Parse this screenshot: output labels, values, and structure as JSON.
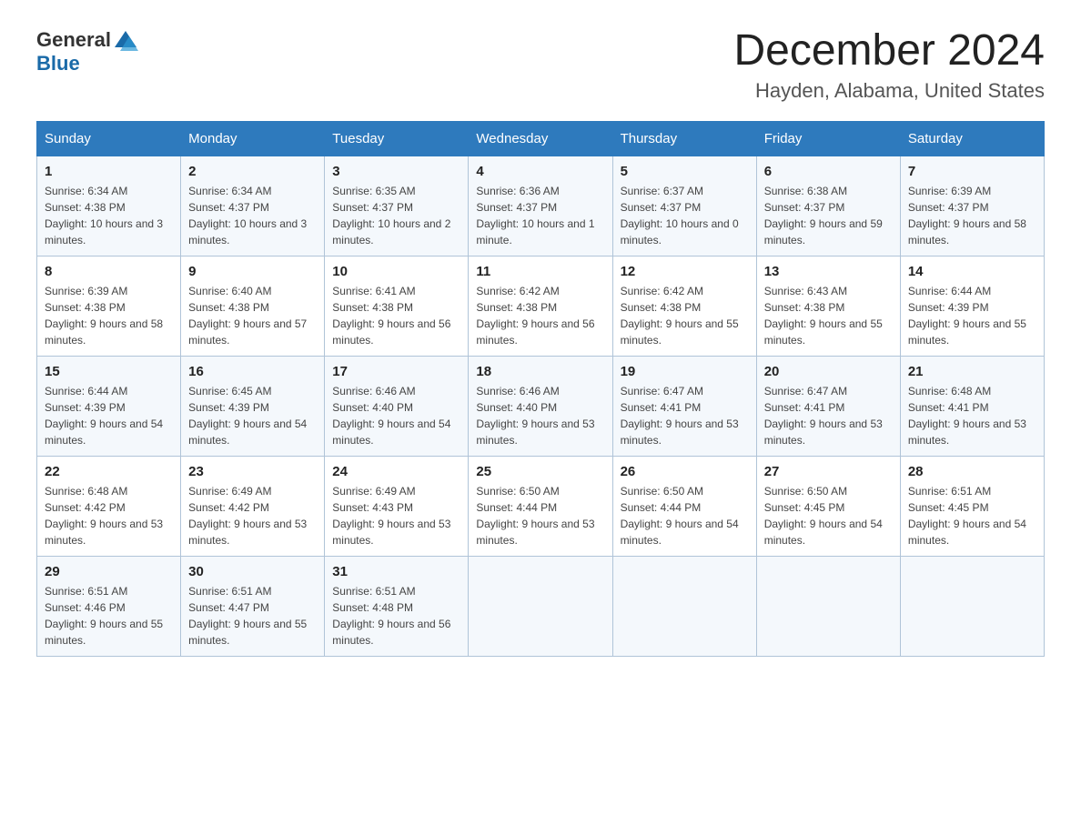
{
  "header": {
    "logo_general": "General",
    "logo_blue": "Blue",
    "month_title": "December 2024",
    "location": "Hayden, Alabama, United States"
  },
  "days_of_week": [
    "Sunday",
    "Monday",
    "Tuesday",
    "Wednesday",
    "Thursday",
    "Friday",
    "Saturday"
  ],
  "weeks": [
    [
      {
        "day": "1",
        "sunrise": "6:34 AM",
        "sunset": "4:38 PM",
        "daylight": "10 hours and 3 minutes."
      },
      {
        "day": "2",
        "sunrise": "6:34 AM",
        "sunset": "4:37 PM",
        "daylight": "10 hours and 3 minutes."
      },
      {
        "day": "3",
        "sunrise": "6:35 AM",
        "sunset": "4:37 PM",
        "daylight": "10 hours and 2 minutes."
      },
      {
        "day": "4",
        "sunrise": "6:36 AM",
        "sunset": "4:37 PM",
        "daylight": "10 hours and 1 minute."
      },
      {
        "day": "5",
        "sunrise": "6:37 AM",
        "sunset": "4:37 PM",
        "daylight": "10 hours and 0 minutes."
      },
      {
        "day": "6",
        "sunrise": "6:38 AM",
        "sunset": "4:37 PM",
        "daylight": "9 hours and 59 minutes."
      },
      {
        "day": "7",
        "sunrise": "6:39 AM",
        "sunset": "4:37 PM",
        "daylight": "9 hours and 58 minutes."
      }
    ],
    [
      {
        "day": "8",
        "sunrise": "6:39 AM",
        "sunset": "4:38 PM",
        "daylight": "9 hours and 58 minutes."
      },
      {
        "day": "9",
        "sunrise": "6:40 AM",
        "sunset": "4:38 PM",
        "daylight": "9 hours and 57 minutes."
      },
      {
        "day": "10",
        "sunrise": "6:41 AM",
        "sunset": "4:38 PM",
        "daylight": "9 hours and 56 minutes."
      },
      {
        "day": "11",
        "sunrise": "6:42 AM",
        "sunset": "4:38 PM",
        "daylight": "9 hours and 56 minutes."
      },
      {
        "day": "12",
        "sunrise": "6:42 AM",
        "sunset": "4:38 PM",
        "daylight": "9 hours and 55 minutes."
      },
      {
        "day": "13",
        "sunrise": "6:43 AM",
        "sunset": "4:38 PM",
        "daylight": "9 hours and 55 minutes."
      },
      {
        "day": "14",
        "sunrise": "6:44 AM",
        "sunset": "4:39 PM",
        "daylight": "9 hours and 55 minutes."
      }
    ],
    [
      {
        "day": "15",
        "sunrise": "6:44 AM",
        "sunset": "4:39 PM",
        "daylight": "9 hours and 54 minutes."
      },
      {
        "day": "16",
        "sunrise": "6:45 AM",
        "sunset": "4:39 PM",
        "daylight": "9 hours and 54 minutes."
      },
      {
        "day": "17",
        "sunrise": "6:46 AM",
        "sunset": "4:40 PM",
        "daylight": "9 hours and 54 minutes."
      },
      {
        "day": "18",
        "sunrise": "6:46 AM",
        "sunset": "4:40 PM",
        "daylight": "9 hours and 53 minutes."
      },
      {
        "day": "19",
        "sunrise": "6:47 AM",
        "sunset": "4:41 PM",
        "daylight": "9 hours and 53 minutes."
      },
      {
        "day": "20",
        "sunrise": "6:47 AM",
        "sunset": "4:41 PM",
        "daylight": "9 hours and 53 minutes."
      },
      {
        "day": "21",
        "sunrise": "6:48 AM",
        "sunset": "4:41 PM",
        "daylight": "9 hours and 53 minutes."
      }
    ],
    [
      {
        "day": "22",
        "sunrise": "6:48 AM",
        "sunset": "4:42 PM",
        "daylight": "9 hours and 53 minutes."
      },
      {
        "day": "23",
        "sunrise": "6:49 AM",
        "sunset": "4:42 PM",
        "daylight": "9 hours and 53 minutes."
      },
      {
        "day": "24",
        "sunrise": "6:49 AM",
        "sunset": "4:43 PM",
        "daylight": "9 hours and 53 minutes."
      },
      {
        "day": "25",
        "sunrise": "6:50 AM",
        "sunset": "4:44 PM",
        "daylight": "9 hours and 53 minutes."
      },
      {
        "day": "26",
        "sunrise": "6:50 AM",
        "sunset": "4:44 PM",
        "daylight": "9 hours and 54 minutes."
      },
      {
        "day": "27",
        "sunrise": "6:50 AM",
        "sunset": "4:45 PM",
        "daylight": "9 hours and 54 minutes."
      },
      {
        "day": "28",
        "sunrise": "6:51 AM",
        "sunset": "4:45 PM",
        "daylight": "9 hours and 54 minutes."
      }
    ],
    [
      {
        "day": "29",
        "sunrise": "6:51 AM",
        "sunset": "4:46 PM",
        "daylight": "9 hours and 55 minutes."
      },
      {
        "day": "30",
        "sunrise": "6:51 AM",
        "sunset": "4:47 PM",
        "daylight": "9 hours and 55 minutes."
      },
      {
        "day": "31",
        "sunrise": "6:51 AM",
        "sunset": "4:48 PM",
        "daylight": "9 hours and 56 minutes."
      },
      null,
      null,
      null,
      null
    ]
  ]
}
